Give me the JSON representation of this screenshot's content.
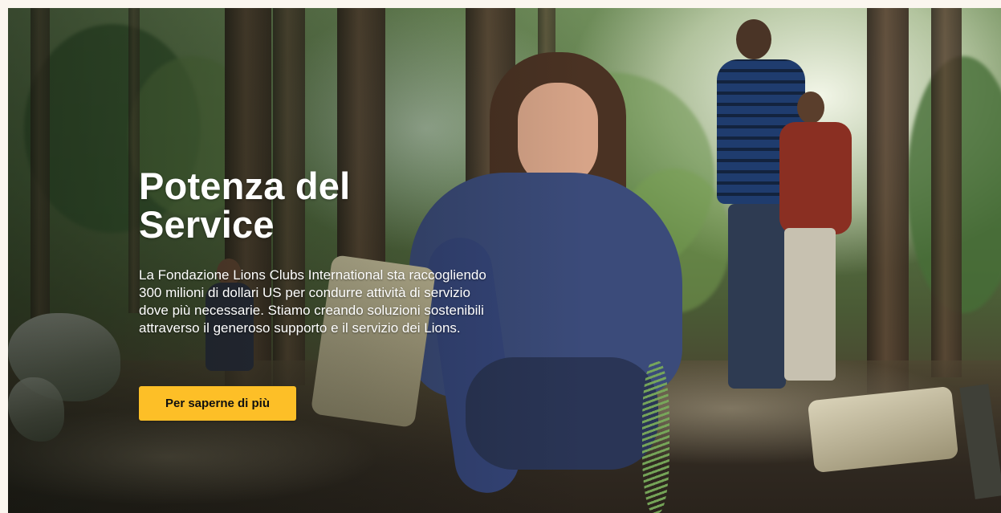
{
  "hero": {
    "title_line1": "Potenza del",
    "title_line2": "Service",
    "description": "La Fondazione Lions Clubs International sta raccogliendo 300 milioni di dollari US per condurre attività di servizio dove più necessarie. Stiamo creando soluzioni sostenibili attraverso il generoso supporto e il servizio dei Lions.",
    "cta_label": "Per saperne di più",
    "image": "forest-volunteers-photo"
  },
  "colors": {
    "accent": "#fdbf27",
    "text": "#ffffff",
    "page_background": "#fbf6ef"
  }
}
